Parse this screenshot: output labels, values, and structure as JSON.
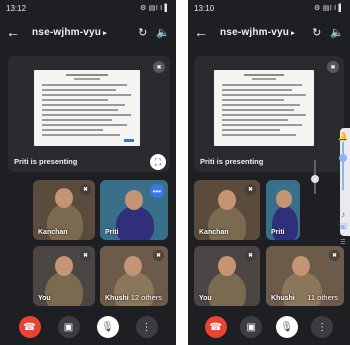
{
  "screens": [
    {
      "status": {
        "time": "13:12",
        "indicators": "⚙ ▤І І ▌"
      },
      "meeting": {
        "code": "nse-wjhm-vyu",
        "caret": "▸"
      },
      "presenter_label": "Priti is presenting",
      "tiles": [
        {
          "name": "Kanchan"
        },
        {
          "name": "Priti"
        },
        {
          "name": "You"
        },
        {
          "name": "Khushi",
          "others": "12 others"
        }
      ]
    },
    {
      "status": {
        "time": "13:10",
        "indicators": "⚙ ▤І І ▌"
      },
      "meeting": {
        "code": "nse-wjhm-vyu",
        "caret": "▸"
      },
      "presenter_label": "Priti is presenting",
      "tiles": [
        {
          "name": "Kanchan"
        },
        {
          "name": "Priti"
        },
        {
          "name": "You"
        },
        {
          "name": "Khushi",
          "others": "11 others"
        }
      ]
    }
  ],
  "icons": {
    "back": "←",
    "switch_camera": "↻",
    "speaker": "🔈",
    "end_call": "☎",
    "camera": "▣",
    "mic_off": "🎙",
    "more": "⋮",
    "muted": "✖",
    "fullscreen": "⛶",
    "bell": "🔔",
    "music": "♪",
    "phone": "☏",
    "settings": "☰"
  },
  "colors": {
    "end_call": "#ea4335",
    "accent": "#3b78e7",
    "background": "#1e1f22"
  },
  "volume_panel": {
    "media_level": 0.45,
    "ring_level": 0.6
  }
}
